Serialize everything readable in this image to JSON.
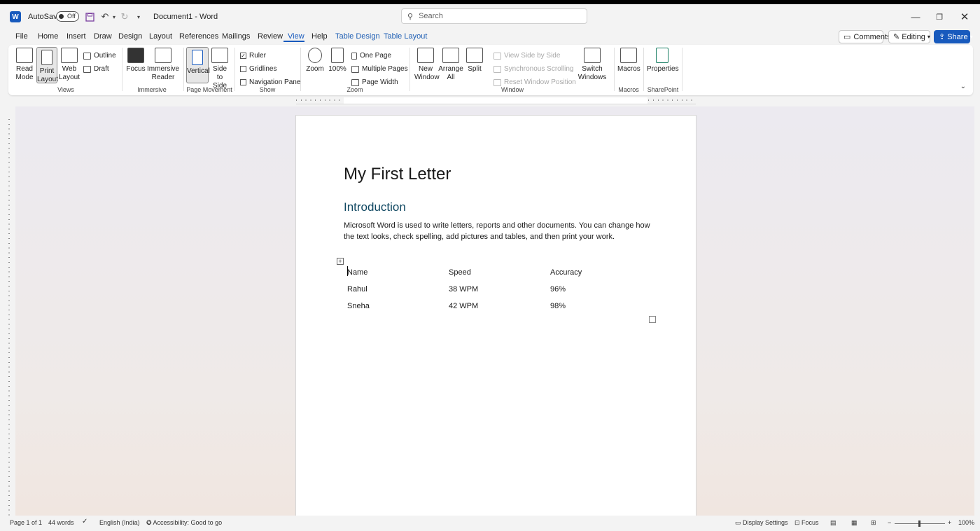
{
  "titlebar": {
    "autosave_label": "AutoSave",
    "autosave_state": "Off",
    "doc_title": "Document1  -  Word",
    "search_placeholder": "Search"
  },
  "menu": {
    "tabs": [
      "File",
      "Home",
      "Insert",
      "Draw",
      "Design",
      "Layout",
      "References",
      "Mailings",
      "Review",
      "View",
      "Help",
      "Table Design",
      "Table Layout"
    ],
    "active_tab": "View",
    "comments": "Comments",
    "editing": "Editing",
    "share": "Share"
  },
  "ribbon": {
    "views": {
      "read_mode": "Read Mode",
      "print_layout": "Print Layout",
      "web_layout": "Web Layout",
      "outline": "Outline",
      "draft": "Draft",
      "group": "Views"
    },
    "immersive": {
      "focus": "Focus",
      "reader": "Immersive Reader",
      "group": "Immersive"
    },
    "page_movement": {
      "vertical": "Vertical",
      "side": "Side to Side",
      "group": "Page Movement"
    },
    "show": {
      "ruler": "Ruler",
      "gridlines": "Gridlines",
      "nav_pane": "Navigation Pane",
      "group": "Show"
    },
    "zoom": {
      "zoom": "Zoom",
      "hundred": "100%",
      "one_page": "One Page",
      "multiple_pages": "Multiple Pages",
      "page_width": "Page Width",
      "group": "Zoom"
    },
    "window": {
      "new_window": "New Window",
      "arrange_all": "Arrange All",
      "split": "Split",
      "view_side": "View Side by Side",
      "sync_scroll": "Synchronous Scrolling",
      "reset_pos": "Reset Window Position",
      "switch": "Switch Windows",
      "group": "Window"
    },
    "macros": {
      "macros": "Macros",
      "group": "Macros"
    },
    "sharepoint": {
      "properties": "Properties",
      "group": "SharePoint"
    }
  },
  "document": {
    "title": "My First Letter",
    "heading": "Introduction",
    "paragraph": "Microsoft Word is used to write letters, reports and other documents. You can change how the text looks, check spelling, add pictures and tables, and then print your work.",
    "table": [
      [
        "Name",
        "Speed",
        "Accuracy"
      ],
      [
        "Rahul",
        "38 WPM",
        "96%"
      ],
      [
        "Sneha",
        "42 WPM",
        "98%"
      ]
    ]
  },
  "status": {
    "page": "Page 1 of 1",
    "words": "44 words",
    "language": "English (India)",
    "accessibility": "Accessibility: Good to go",
    "display_settings": "Display Settings",
    "focus": "Focus",
    "zoom": "100%"
  },
  "colors": {
    "accent": "#185abd",
    "heading": "#0f4761"
  }
}
